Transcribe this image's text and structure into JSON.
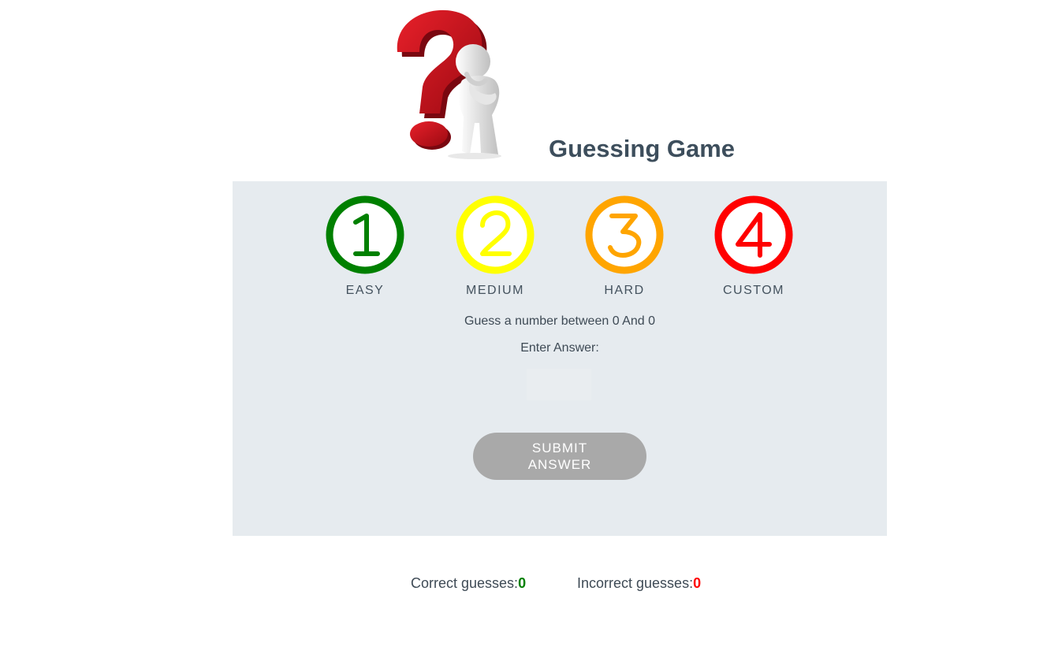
{
  "header": {
    "title": "Guessing Game",
    "logo_icon": "question-mark-thinking-person-icon"
  },
  "levels": [
    {
      "number": "1",
      "label": "EASY",
      "color": "#008000"
    },
    {
      "number": "2",
      "label": "MEDIUM",
      "color": "#ffff00"
    },
    {
      "number": "3",
      "label": "HARD",
      "color": "#ffa500"
    },
    {
      "number": "4",
      "label": "CUSTOM",
      "color": "#ff0000"
    }
  ],
  "game": {
    "instruction": "Guess a number between 0 And 0",
    "enter_label": "Enter Answer:",
    "answer_value": "",
    "submit_label": "SUBMIT ANSWER"
  },
  "score": {
    "correct_label": "Correct guesses:",
    "correct_value": "0",
    "correct_color": "#008000",
    "incorrect_label": "Incorrect guesses:",
    "incorrect_value": "0",
    "incorrect_color": "#ff0000"
  },
  "colors": {
    "panel_background": "#e6ebef",
    "title_text": "#3d4e5c",
    "button_background": "#a9a9a9"
  }
}
